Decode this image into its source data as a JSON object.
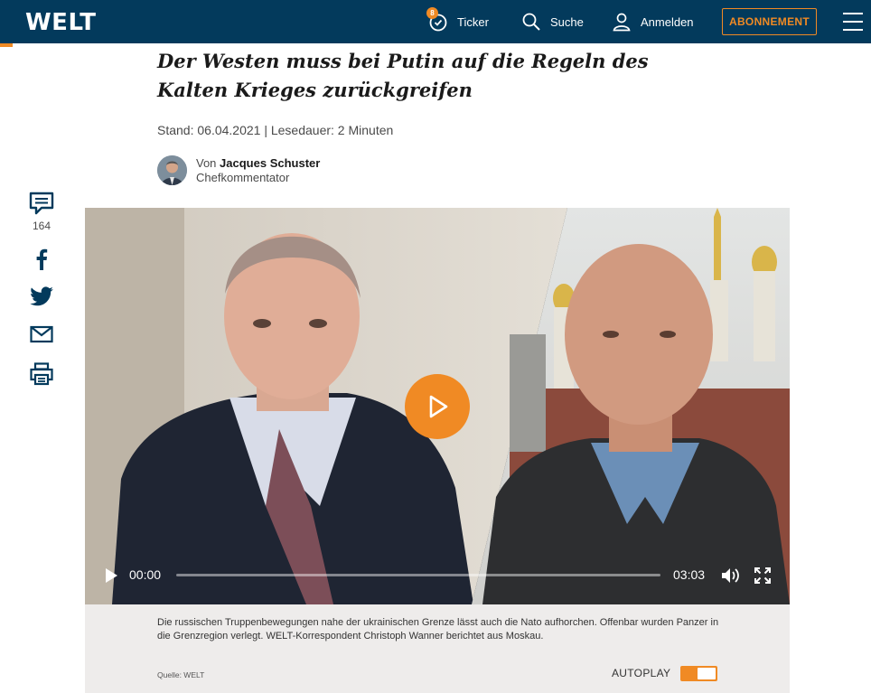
{
  "header": {
    "logo": "WELT",
    "ticker_badge": "8",
    "ticker_label": "Ticker",
    "search_label": "Suche",
    "login_label": "Anmelden",
    "subscribe_label": "ABONNEMENT"
  },
  "article": {
    "headline": "Der Westen muss bei Putin auf die Regeln des Kalten Krieges zurückgreifen",
    "meta": "Stand: 06.04.2021 | Lesedauer: 2 Minuten",
    "author_prefix": "Von",
    "author_name": "Jacques Schuster",
    "author_role": "Chefkommentator"
  },
  "share": {
    "comment_count": "164"
  },
  "video": {
    "current_time": "00:00",
    "duration": "03:03",
    "progress": 0,
    "caption": "Die russischen Truppenbewegungen nahe der ukrainischen Grenze lässt auch die Nato aufhorchen. Offenbar wurden Panzer in die Grenzregion verlegt. WELT-Korrespondent Christoph Wanner berichtet aus Moskau.",
    "source": "Quelle: WELT",
    "autoplay_label": "AUTOPLAY",
    "autoplay_on": true
  },
  "colors": {
    "header_bg": "#033a5c",
    "accent": "#f08a24",
    "icon_blue": "#033a5c"
  }
}
